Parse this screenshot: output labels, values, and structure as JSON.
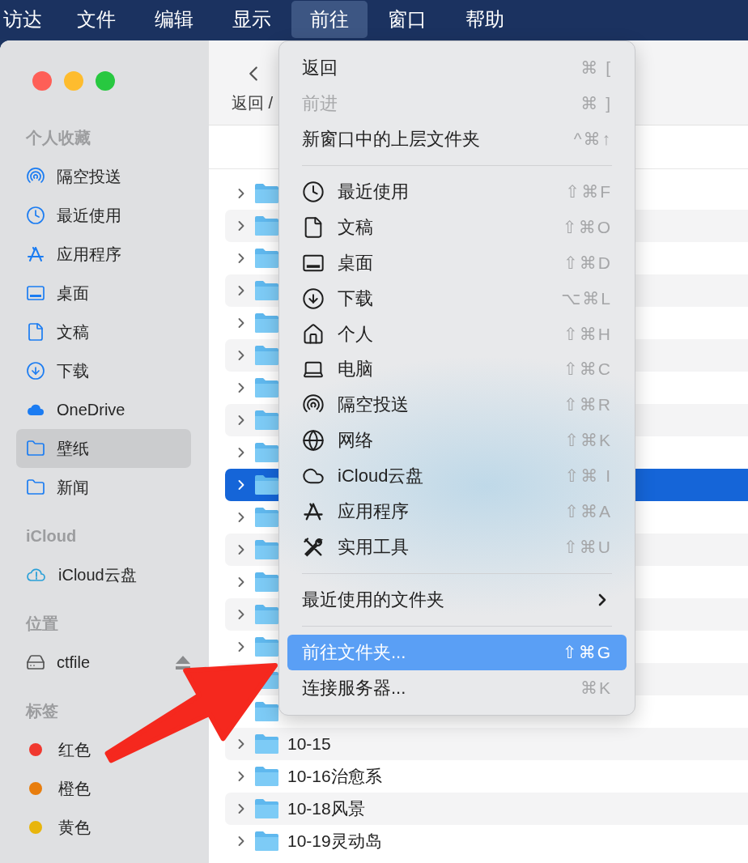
{
  "menubar": {
    "items": [
      {
        "label": "访达",
        "selected": false
      },
      {
        "label": "文件",
        "selected": false
      },
      {
        "label": "编辑",
        "selected": false
      },
      {
        "label": "显示",
        "selected": false
      },
      {
        "label": "前往",
        "selected": true
      },
      {
        "label": "窗口",
        "selected": false
      },
      {
        "label": "帮助",
        "selected": false
      }
    ]
  },
  "sidebar": {
    "sections": [
      {
        "title": "个人收藏",
        "items": [
          {
            "label": "隔空投送",
            "kind": "airdrop",
            "selected": false
          },
          {
            "label": "最近使用",
            "kind": "clock",
            "selected": false
          },
          {
            "label": "应用程序",
            "kind": "apps",
            "selected": false
          },
          {
            "label": "桌面",
            "kind": "desktop",
            "selected": false
          },
          {
            "label": "文稿",
            "kind": "document",
            "selected": false
          },
          {
            "label": "下载",
            "kind": "download",
            "selected": false
          },
          {
            "label": "OneDrive",
            "kind": "cloud_filled",
            "selected": false
          },
          {
            "label": "壁纸",
            "kind": "folder",
            "selected": true
          },
          {
            "label": "新闻",
            "kind": "folder",
            "selected": false
          }
        ]
      },
      {
        "title": "iCloud",
        "items": [
          {
            "label": "iCloud云盘",
            "kind": "icloud_alert",
            "selected": false
          }
        ]
      },
      {
        "title": "位置",
        "items": [
          {
            "label": "ctfile",
            "kind": "drive",
            "selected": false,
            "ejectable": true
          }
        ]
      },
      {
        "title": "标签",
        "items": [
          {
            "label": "红色",
            "kind": "tag",
            "color": "#f0382f",
            "selected": false
          },
          {
            "label": "橙色",
            "kind": "tag",
            "color": "#e87d0d",
            "selected": false
          },
          {
            "label": "黄色",
            "kind": "tag",
            "color": "#e8b50c",
            "selected": false
          }
        ]
      }
    ]
  },
  "toolbar": {
    "back_label": "返回 /"
  },
  "files": [
    {
      "selected": false
    },
    {
      "selected": false
    },
    {
      "selected": false
    },
    {
      "selected": false
    },
    {
      "selected": false
    },
    {
      "selected": false
    },
    {
      "selected": false
    },
    {
      "selected": false
    },
    {
      "selected": false
    },
    {
      "selected": true
    },
    {
      "selected": false
    },
    {
      "selected": false
    },
    {
      "selected": false
    },
    {
      "selected": false
    },
    {
      "selected": false
    },
    {
      "selected": false,
      "chevron_visible": false
    },
    {
      "selected": false,
      "chevron_visible": false
    },
    {
      "name": "10-15",
      "selected": false
    },
    {
      "name": "10-16治愈系",
      "selected": false
    },
    {
      "name": "10-18风景",
      "selected": false
    },
    {
      "name": "10-19灵动岛",
      "selected": false
    }
  ],
  "menu": {
    "items": [
      {
        "kind": "item",
        "label": "返回",
        "shortcut": "⌘ [",
        "disabled": false,
        "selected": false
      },
      {
        "kind": "item",
        "label": "前进",
        "shortcut": "⌘ ]",
        "disabled": true,
        "selected": false
      },
      {
        "kind": "item",
        "label": "新窗口中的上层文件夹",
        "shortcut": "^⌘↑",
        "disabled": false,
        "selected": false
      },
      {
        "kind": "separator"
      },
      {
        "kind": "clock",
        "label": "最近使用",
        "shortcut": "⇧⌘F",
        "disabled": false,
        "selected": false
      },
      {
        "kind": "document",
        "label": "文稿",
        "shortcut": "⇧⌘O",
        "disabled": false,
        "selected": false
      },
      {
        "kind": "desktop",
        "label": "桌面",
        "shortcut": "⇧⌘D",
        "disabled": false,
        "selected": false
      },
      {
        "kind": "download",
        "label": "下载",
        "shortcut": "⌥⌘L",
        "disabled": false,
        "selected": false
      },
      {
        "kind": "home",
        "label": "个人",
        "shortcut": "⇧⌘H",
        "disabled": false,
        "selected": false
      },
      {
        "kind": "laptop",
        "label": "电脑",
        "shortcut": "⇧⌘C",
        "disabled": false,
        "selected": false
      },
      {
        "kind": "airdrop",
        "label": "隔空投送",
        "shortcut": "⇧⌘R",
        "disabled": false,
        "selected": false
      },
      {
        "kind": "globe",
        "label": "网络",
        "shortcut": "⇧⌘K",
        "disabled": false,
        "selected": false
      },
      {
        "kind": "cloud",
        "label": "iCloud云盘",
        "shortcut": "⇧⌘ I",
        "disabled": false,
        "selected": false
      },
      {
        "kind": "apps",
        "label": "应用程序",
        "shortcut": "⇧⌘A",
        "disabled": false,
        "selected": false
      },
      {
        "kind": "tools",
        "label": "实用工具",
        "shortcut": "⇧⌘U",
        "disabled": false,
        "selected": false
      },
      {
        "kind": "separator"
      },
      {
        "kind": "submenu",
        "label": "最近使用的文件夹",
        "disabled": false,
        "selected": false
      },
      {
        "kind": "separator"
      },
      {
        "kind": "item",
        "label": "前往文件夹...",
        "shortcut": "⇧⌘G",
        "disabled": false,
        "selected": true
      },
      {
        "kind": "item",
        "label": "连接服务器...",
        "shortcut": "⌘K",
        "disabled": false,
        "selected": false
      }
    ]
  }
}
